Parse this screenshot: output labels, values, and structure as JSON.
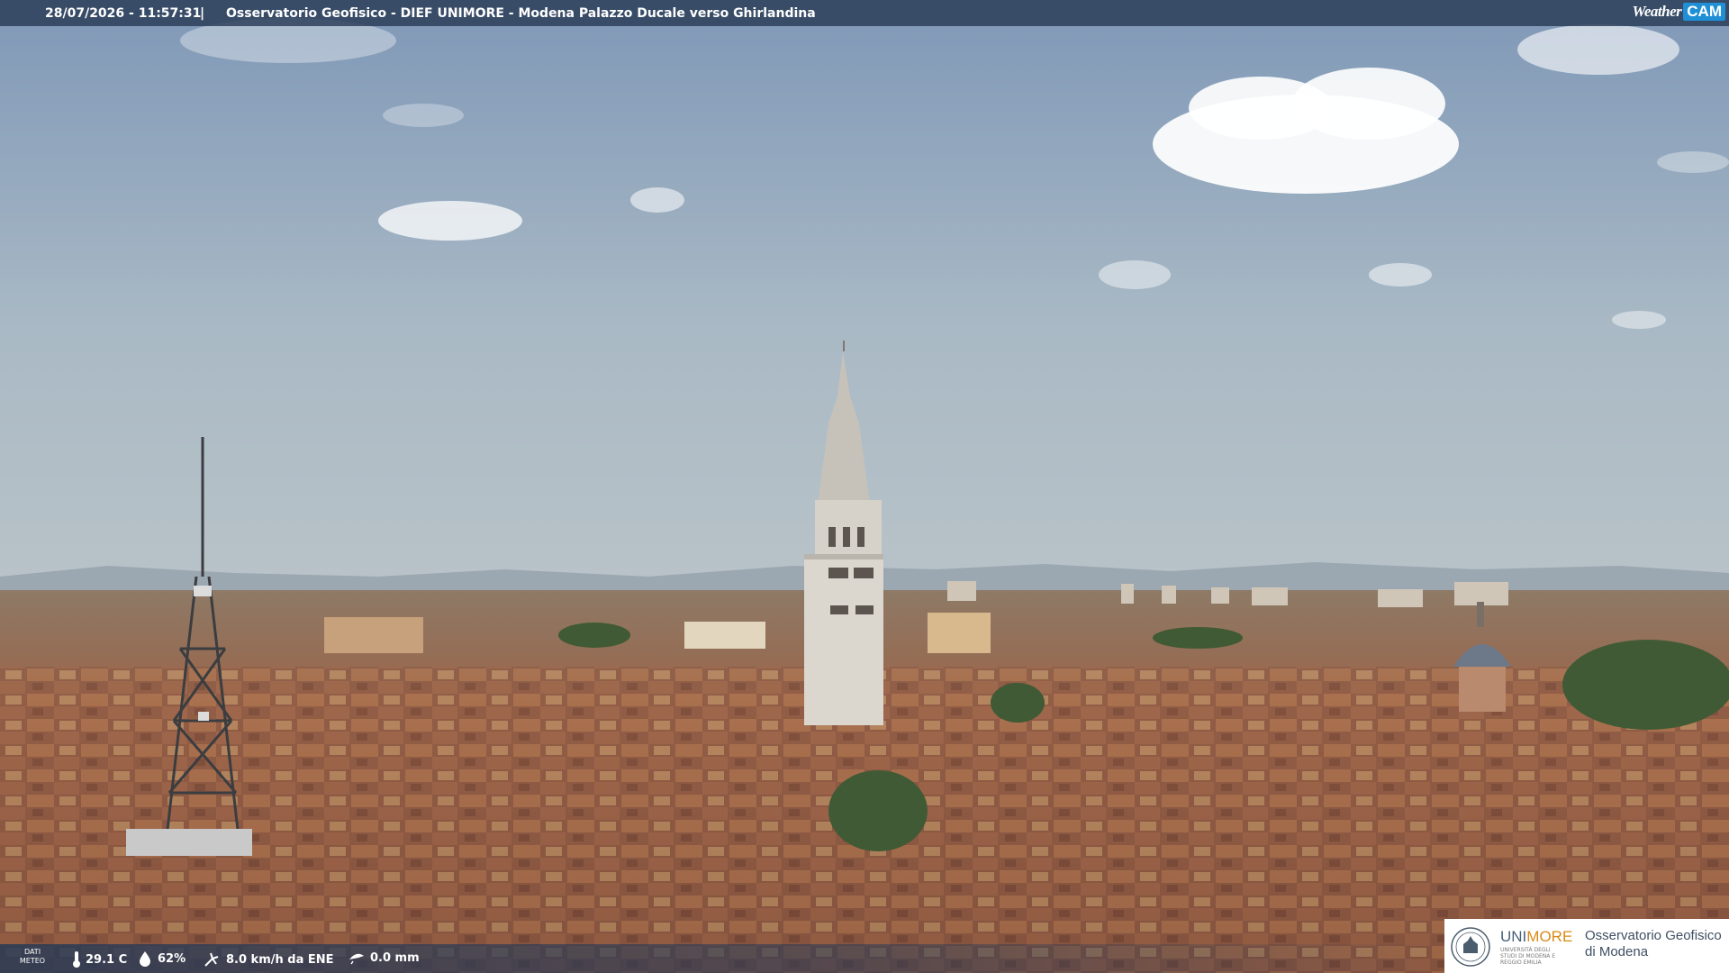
{
  "header": {
    "datetime": "28/07/2026 - 11:57:31",
    "separator": "|",
    "title": "Osservatorio Geofisico - DIEF UNIMORE - Modena Palazzo Ducale verso Ghirlandina",
    "brand_weather": "Weather",
    "brand_cam": "CAM"
  },
  "weather": {
    "label_line1": "DATI",
    "label_line2": "METEO",
    "temperature": "29.1 C",
    "humidity": "62%",
    "wind": "8.0 km/h da ENE",
    "rain": "0.0 mm"
  },
  "logo": {
    "uni_part1": "UNI",
    "uni_part2": "MORE",
    "uni_subtitle": "UNIVERSITÀ DEGLI STUDI DI MODENA E REGGIO EMILIA",
    "obs_line1": "Osservatorio Geofisico",
    "obs_line2": "di Modena"
  },
  "colors": {
    "sky_top": "#7f98b7",
    "sky_bottom": "#aebdc7",
    "roofs": "#8a5a44",
    "tower": "#d8d4cc",
    "bar": "#283a56"
  },
  "icons": [
    "thermometer-icon",
    "humidity-icon",
    "wind-icon",
    "rain-icon",
    "unimore-seal-icon"
  ]
}
